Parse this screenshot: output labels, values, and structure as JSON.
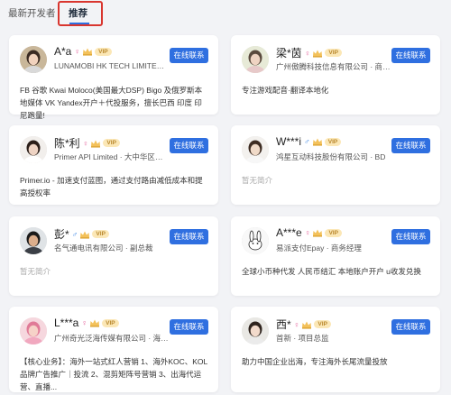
{
  "tabs": {
    "latest": "最新开发者",
    "recommended": "推荐"
  },
  "contact_label": "在线联系",
  "vip_label": "VIP",
  "cards": [
    {
      "name": "A*a",
      "gender": "female",
      "company": "LUNAMOBI HK TECH LIMITED · ...",
      "desc": "FB 谷歌 Kwai Moloco(美国最大DSP) Bigo 及俄罗斯本地媒体 VK Yandex开户＋代投服务，擅长巴西 印度 印尼跑量!",
      "desc_empty": false
    },
    {
      "name": "梁*茵",
      "gender": "female",
      "company": "广州傲腾科技信息有限公司 · 商务...",
      "desc": "专注游戏配音·翻译本地化",
      "desc_empty": false
    },
    {
      "name": "陈*利",
      "gender": "female",
      "company": "Primer API Limited · 大中华区市场...",
      "desc": "Primer.io - 加速支付蓝图，通过支付路由减低成本和提高授权率",
      "desc_empty": false
    },
    {
      "name": "W***i",
      "gender": "male",
      "company": "鸿星互动科技股份有限公司 · BD",
      "desc": "暂无简介",
      "desc_empty": true
    },
    {
      "name": "彭*",
      "gender": "male",
      "company": "名气通电讯有限公司 · 副总裁",
      "desc": "暂无简介",
      "desc_empty": true
    },
    {
      "name": "A***e",
      "gender": "female",
      "company": "易派支付Epay · 商务经理",
      "desc": "全球小币种代发 人民币结汇 本地账户开户 u收发兑换",
      "desc_empty": false
    },
    {
      "name": "L***a",
      "gender": "female",
      "company": "广州奇光泛海传媒有限公司 · 海外...",
      "desc": "【核心业务】：海外一站式红人营销 1、海外KOC、KOL品牌广告推广｜投流 2、混剪矩阵号营销 3、出海代运营、直播...",
      "desc_empty": false
    },
    {
      "name": "西*",
      "gender": "female",
      "company": "首新 · 项目总监",
      "desc": "助力中国企业出海，专注海外长尾流量投放",
      "desc_empty": false
    }
  ],
  "avatar_styles": [
    {
      "bg": "#c9b79a",
      "skin": "#f1d2bd",
      "hair": "#3a2a22",
      "shirt": "#d9d9d9"
    },
    {
      "bg": "#e7ead7",
      "skin": "#efd4c2",
      "hair": "#5a4a3d",
      "shirt": "#e7c9c9"
    },
    {
      "bg": "#f2efec",
      "skin": "#eed3c3",
      "hair": "#2a1d18",
      "shirt": "#ffffff"
    },
    {
      "bg": "#f3f1ee",
      "skin": "#f0dac8",
      "hair": "#3d2c22",
      "shirt": "#f7f7f7"
    },
    {
      "bg": "#dfe3e6",
      "skin": "#dcae8c",
      "hair": "#1a1a1a",
      "shirt": "#3b3f46"
    },
    {
      "bg": "#f8f8f8",
      "skin": "#ffffff",
      "hair": "#222222",
      "shirt": "#ffffff"
    },
    {
      "bg": "#f6d7de",
      "skin": "#f6d2c8",
      "hair": "#e07a97",
      "shirt": "#f1a8bf"
    },
    {
      "bg": "#e9e8e4",
      "skin": "#f2dacb",
      "hair": "#2f241e",
      "shirt": "#ebebeb"
    }
  ]
}
